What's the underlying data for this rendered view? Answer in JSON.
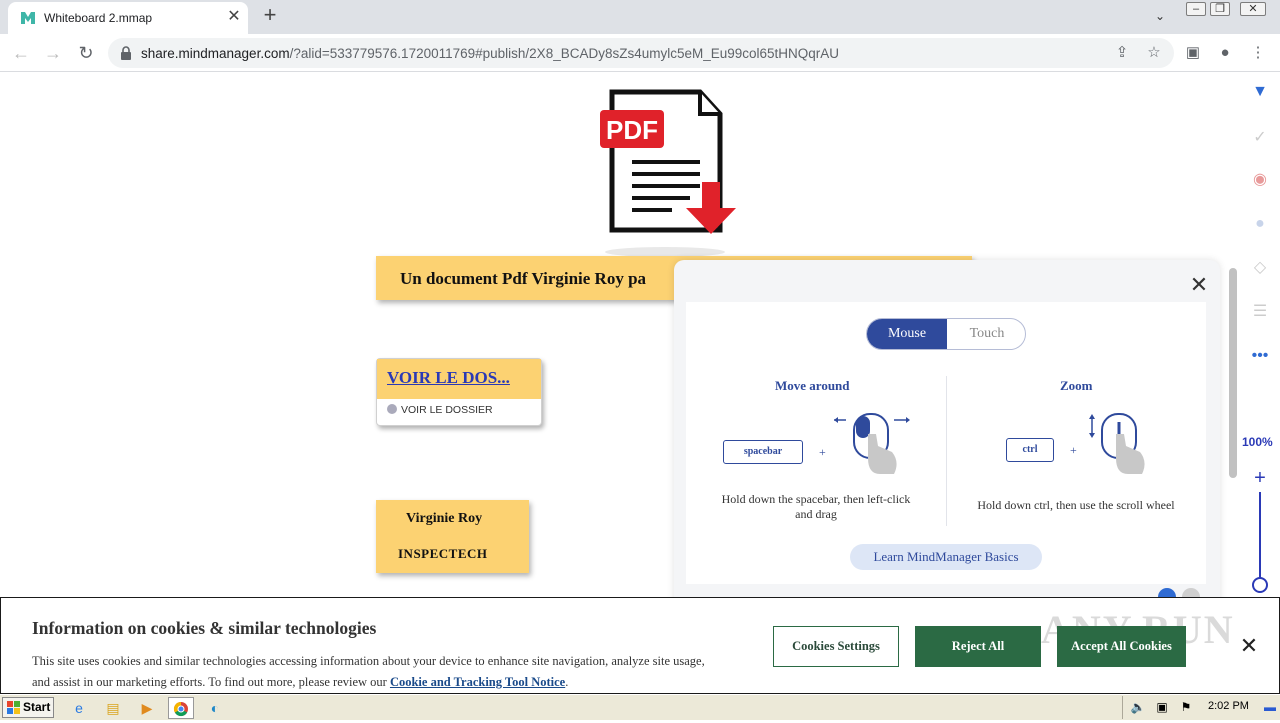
{
  "browser": {
    "tab_title": "Whiteboard 2.mmap",
    "new_tab_label": "+",
    "url_host": "share.mindmanager.com",
    "url_rest": "/?alid=533779576.1720011769#publish/2X8_BCADy8sZs4umylc5eM_Eu99col65tHNQqrAU"
  },
  "map": {
    "main_topic": "Un document Pdf Virginie Roy pa",
    "link_topic": "VOIR LE DOS...",
    "link_note": "VOIR LE DOSSIER",
    "name_topic_line1": "Virginie Roy",
    "name_topic_line2": "INSPECTECH",
    "pdf_label": "PDF"
  },
  "rail": {
    "zoom": "100%"
  },
  "help_panel": {
    "tabs": [
      "Mouse",
      "Touch"
    ],
    "move_title": "Move around",
    "move_key": "spacebar",
    "move_desc": "Hold down the spacebar, then left-click and drag",
    "zoom_title": "Zoom",
    "zoom_key": "ctrl",
    "zoom_desc": "Hold down ctrl, then use the scroll wheel",
    "learn_button": "Learn MindManager Basics",
    "plus": "+"
  },
  "cookie": {
    "title": "Information on cookies & similar technologies",
    "body": "This site uses cookies and similar technologies accessing information about your device to enhance site navigation, analyze site usage, and assist in our marketing efforts. To find out more, please review our ",
    "link": "Cookie and Tracking Tool Notice",
    "period": ".",
    "settings_button": "Cookies Settings",
    "reject_button": "Reject All",
    "accept_button": "Accept All Cookies",
    "watermark": "ANY.RUN"
  },
  "taskbar": {
    "start_label": "Start",
    "clock": "2:02 PM"
  },
  "colors": {
    "topic_fill": "#fcd272",
    "mindmanager_blue": "#2f4a9c",
    "cookie_green": "#2b6a44"
  }
}
